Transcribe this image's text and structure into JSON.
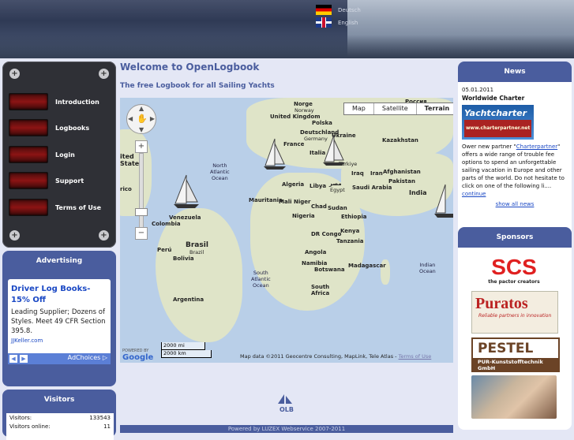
{
  "header": {
    "languages": [
      {
        "label": "Deutsch",
        "flag": "de"
      },
      {
        "label": "English",
        "flag": "uk"
      }
    ]
  },
  "nav": {
    "items": [
      {
        "label": "Introduction"
      },
      {
        "label": "Logbooks"
      },
      {
        "label": "Login"
      },
      {
        "label": "Support"
      },
      {
        "label": "Terms of Use"
      }
    ]
  },
  "advertising": {
    "heading": "Advertising",
    "ad_title": "Driver Log Books- 15% Off",
    "ad_text": "Leading Supplier; Dozens of Styles. Meet 49 CFR Section 395.8.",
    "ad_source": "JJKeller.com",
    "adchoices": "AdChoices"
  },
  "visitors": {
    "heading": "Visitors",
    "rows": [
      {
        "label": "Visitors:",
        "value": "133543"
      },
      {
        "label": "Visitors online:",
        "value": "11"
      }
    ]
  },
  "main": {
    "title": "Welcome to OpenLogbook",
    "subtitle": "The free Logbook for all Sailing Yachts"
  },
  "map": {
    "types": [
      "Map",
      "Satellite",
      "Terrain"
    ],
    "selected_type": "Terrain",
    "scale": {
      "miles": "2000 mi",
      "km": "2000 km"
    },
    "attribution": "Map data ©2011 Geocentre Consulting, MapLink, Tele Atlas -",
    "terms_link": "Terms of Use",
    "powered_by": "POWERED BY",
    "google": "Google",
    "labels": {
      "russia": "Россия",
      "norway": "Norge\nNorway",
      "uk": "United Kingdom",
      "poland": "Polska\nPoland",
      "germany": "Deutschland\nGermany",
      "ukraine": "Ukraine",
      "kazakhstan": "Kazakhstan",
      "france": "France",
      "italy": "Italia\nItaly",
      "turkey": "Türkiye",
      "iraq": "Iraq",
      "iran": "Iran",
      "afghanistan": "Afghanistan",
      "pakistan": "Pakistan",
      "algeria": "Algeria",
      "libya": "Libya",
      "egypt": "مصر\nEgypt",
      "saudi": "Saudi Arabia",
      "india": "India",
      "mauritania": "Mauritania",
      "mali": "Mali",
      "niger": "Niger",
      "chad": "Chad",
      "sudan": "Sudan",
      "nigeria": "Nigeria",
      "ethiopia": "Ethiopia",
      "kenya": "Kenya",
      "drc": "DR Congo",
      "tanzania": "Tanzania",
      "angola": "Angola",
      "namibia": "Namibia",
      "botswana": "Botswana",
      "madagascar": "Madagascar",
      "southafrica": "South Africa",
      "venezuela": "Venezuela",
      "colombia": "Colombia",
      "brasil": "Brasil\nBrazil",
      "peru": "Perú",
      "bolivia": "Bolivia",
      "argentina": "Argentina",
      "northatlantic": "North Atlantic Ocean",
      "southatlantic": "South Atlantic Ocean",
      "indianocean": "Indian Ocean",
      "unitedstates": "ited States",
      "mexico": "rico",
      "ocean": "Ocean"
    }
  },
  "footer": {
    "text": "Powered by LUZEX Webservice 2007-2011"
  },
  "news": {
    "heading": "News",
    "date": "05.01.2011",
    "title": "Worldwide Charter",
    "banner": "Yachtcharter",
    "banner_url": "www.charterpartner.net",
    "body_pre": "Ower new partner \"",
    "body_link": "Charterpartner",
    "body_post": "\" offers a wide range of trouble fee options to spend an unforgettable sailing vacation in Europe and other parts of the world. Do not hesitate to click on one of the following li....",
    "continue": "continue",
    "show_all": "show all news"
  },
  "sponsors": {
    "heading": "Sponsors",
    "scs": "SCS",
    "scs_sub": "the pactor creators",
    "puratos": "Puratos",
    "puratos_sub": "Reliable partners in innovation",
    "pestel": "PESTEL",
    "pestel_sub": "PUR-Kunststofftechnik GmbH"
  },
  "colors": {
    "accent": "#4a5d9e",
    "nav_bg": "#2f3036",
    "page_bg": "#e4e7f5"
  }
}
